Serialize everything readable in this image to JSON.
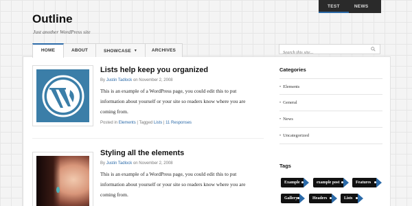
{
  "topnav": {
    "items": [
      "TEST",
      "NEWS"
    ],
    "dropdown": "▾"
  },
  "header": {
    "site_title": "Outline",
    "tagline": "Just another WordPress site"
  },
  "tabs": [
    {
      "label": "HOME",
      "active": true
    },
    {
      "label": "ABOUT",
      "active": false
    },
    {
      "label": "SHOWCASE",
      "active": false,
      "caret": "▼"
    },
    {
      "label": "ARCHIVES",
      "active": false
    }
  ],
  "search": {
    "placeholder": "Search this site..."
  },
  "posts": [
    {
      "title": "Lists help keep you organized",
      "by": "By",
      "author": "Justin Tadlock",
      "on": "on November 2, 2008",
      "excerpt": "This is an example of a WordPress page, you could edit this to put information about yourself or your site so readers know where you are coming from.",
      "posted_in": "Posted in",
      "category": "Elements",
      "tagged": "| Tagged",
      "tag": "Lists",
      "sep": "|",
      "responses": "11 Responses",
      "thumb_icon": "wordpress-logo-icon"
    },
    {
      "title": "Styling all the elements",
      "by": "By",
      "author": "Justin Tadlock",
      "on": "on November 2, 2008",
      "excerpt": "This is an example of a WordPress page, you could edit this to put information about yourself or your site so readers know where you are coming from.",
      "thumb_icon": "woman-portrait-photo"
    }
  ],
  "sidebar": {
    "categories_heading": "Categories",
    "categories": [
      "Elements",
      "General",
      "News",
      "Uncategorized"
    ],
    "bullet": "•",
    "tags_heading": "Tags",
    "tags": [
      "Example",
      "example post",
      "Features",
      "Gallery",
      "Headers",
      "Lists"
    ]
  },
  "colors": {
    "accent": "#2b6aa8",
    "wp_blue": "#3b7ea8",
    "dark": "#2a2a2a"
  }
}
